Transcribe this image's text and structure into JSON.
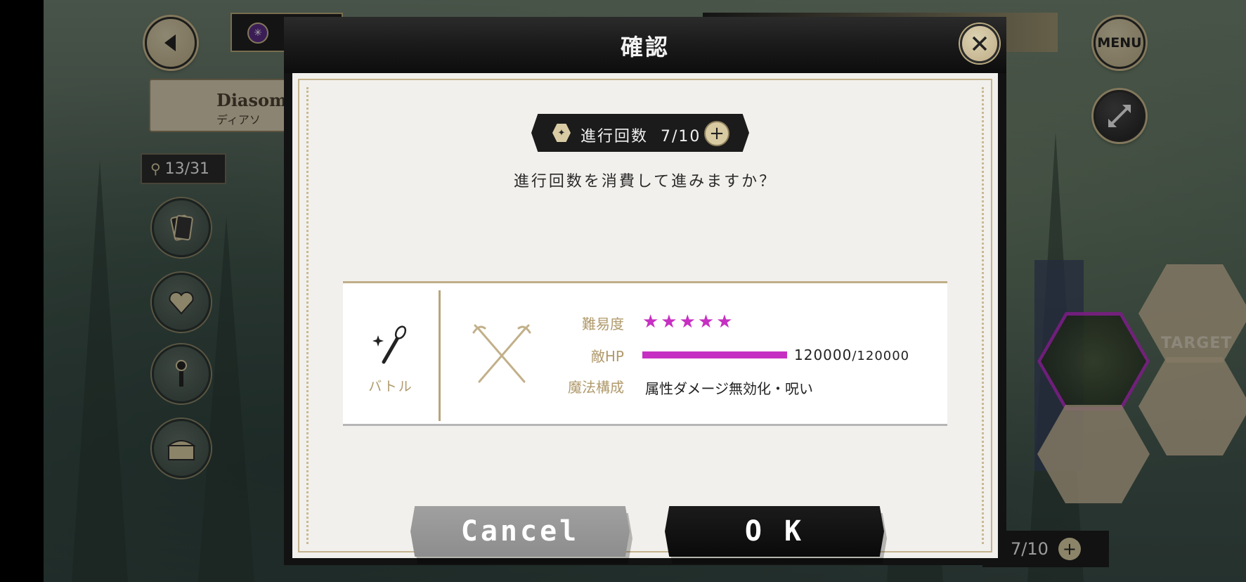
{
  "hud": {
    "menu_label": "MENU",
    "region_name": "Diasomn",
    "region_subname": "ディアソ",
    "map_progress": "13/31",
    "target_label": "TARGET",
    "bottom_progress": "7/10"
  },
  "dialog": {
    "title": "確認",
    "progress_label": "進行回数",
    "progress_value": "7/10",
    "question": "進行回数を消費して進みますか？",
    "type_label": "バトル",
    "difficulty_label": "難易度",
    "difficulty_stars": "★★★★★",
    "difficulty_value": 5,
    "hp_label": "敵HP",
    "hp_current": "120000",
    "hp_max": "/120000",
    "hp_fraction": 1.0,
    "magic_label": "魔法構成",
    "magic_value": "属性ダメージ無効化・呪い",
    "cancel_label": "Cancel",
    "ok_label": "O K"
  },
  "colors": {
    "accent_magenta": "#c630c2",
    "gold": "#b09a6c",
    "panel_bg": "#f2f0ec",
    "header_bg": "#1a1a1a"
  },
  "icons": [
    "back-arrow-icon",
    "expand-icon",
    "pin-icon",
    "cards-icon",
    "heart-icon",
    "wand-icon",
    "chest-icon",
    "close-icon",
    "hex-token-icon",
    "plus-icon",
    "wand-battle-icon",
    "crossed-tridents-icon"
  ]
}
